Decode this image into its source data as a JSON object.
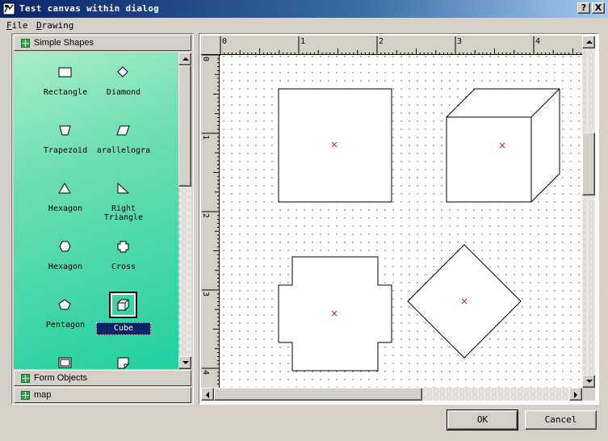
{
  "window": {
    "title": "Test canvas within dialog",
    "help_glyph": "?",
    "close_glyph": "X"
  },
  "menu": {
    "file": {
      "accel": "F",
      "rest": "ile"
    },
    "drawing": {
      "accel": "D",
      "rest": "rawing"
    }
  },
  "palette": {
    "groups": [
      {
        "label": "Simple Shapes",
        "expanded": true
      },
      {
        "label": "Form Objects",
        "expanded": false
      },
      {
        "label": "map",
        "expanded": false
      }
    ],
    "shapes": [
      {
        "label": "Rectangle",
        "icon": "rectangle-icon"
      },
      {
        "label": "Diamond",
        "icon": "diamond-icon"
      },
      {
        "label": "Trapezoid",
        "icon": "trapezoid-icon"
      },
      {
        "label": "arallelogra",
        "icon": "parallelogram-icon"
      },
      {
        "label": "Hexagon",
        "icon": "triangle-icon"
      },
      {
        "label": "Right\nTriangle",
        "icon": "right-triangle-icon"
      },
      {
        "label": "Hexagon",
        "icon": "hexagon-icon"
      },
      {
        "label": "Cross",
        "icon": "cross-icon"
      },
      {
        "label": "Pentagon",
        "icon": "pentagon-icon"
      },
      {
        "label": "Cube",
        "icon": "cube-icon",
        "selected": true
      },
      {
        "label": "",
        "icon": "frame-icon"
      },
      {
        "label": "",
        "icon": "note-icon"
      }
    ]
  },
  "ruler": {
    "horizontal_labels": [
      "0",
      "1",
      "2",
      "3",
      "4"
    ],
    "vertical_labels": [
      "0",
      "1",
      "2",
      "3",
      "4"
    ]
  },
  "canvas_shapes": [
    {
      "type": "square",
      "name": "square-shape"
    },
    {
      "type": "cube",
      "name": "cube-shape"
    },
    {
      "type": "cross",
      "name": "cross-shape"
    },
    {
      "type": "diamond",
      "name": "diamond-shape"
    }
  ],
  "buttons": {
    "ok": "OK",
    "cancel": "Cancel"
  },
  "colors": {
    "title_bar_start": "#0a246a",
    "title_bar_end": "#a6caf0",
    "palette_green": "#22cfa0",
    "center_marker": "#e02020",
    "selection": "#0a246a"
  }
}
